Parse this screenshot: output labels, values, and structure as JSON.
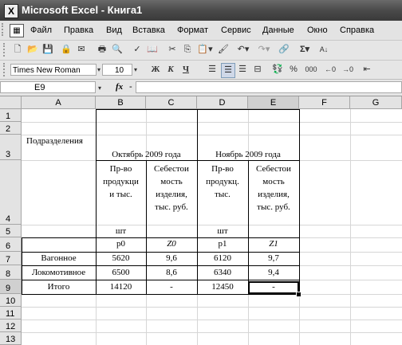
{
  "window": {
    "title": "Microsoft Excel - Книга1",
    "app_icon": "X"
  },
  "menu": [
    "Файл",
    "Правка",
    "Вид",
    "Вставка",
    "Формат",
    "Сервис",
    "Данные",
    "Окно",
    "Справка"
  ],
  "format": {
    "font": "Times New Roman",
    "size": "10",
    "bold": "Ж",
    "italic": "К",
    "underline": "Ч",
    "percent": "%",
    "thousands": "000"
  },
  "formula": {
    "cell": "E9",
    "fx": "fx",
    "value": "-"
  },
  "columns": [
    "A",
    "B",
    "C",
    "D",
    "E",
    "F",
    "G"
  ],
  "rows": [
    "1",
    "2",
    "3",
    "4",
    "5",
    "6",
    "7",
    "8",
    "9",
    "10",
    "11",
    "12",
    "13"
  ],
  "sheet": {
    "a3": "Подразделения",
    "b3": "Октябрь 2009 года",
    "d3": "Ноябрь 2009 года",
    "b4": [
      "Пр-во",
      "продукци",
      "и тыс."
    ],
    "c4": [
      "Себестои",
      "мость",
      "изделия,",
      "тыс. руб."
    ],
    "d4": [
      "Пр-во",
      "продукц.",
      "тыс."
    ],
    "e4": [
      "Себестои",
      "мость",
      "изделия,",
      "тыс. руб."
    ],
    "b5": "шт",
    "d5": "шт",
    "b6": "p0",
    "c6": "Z0",
    "d6": "p1",
    "e6": "Z1",
    "rows_data": [
      {
        "a": "Вагонное",
        "b": "5620",
        "c": "9,6",
        "d": "6120",
        "e": "9,7"
      },
      {
        "a": "Локомотивное",
        "b": "6500",
        "c": "8,6",
        "d": "6340",
        "e": "9,4"
      },
      {
        "a": "Итого",
        "b": "14120",
        "c": "-",
        "d": "12450",
        "e": "-"
      }
    ]
  }
}
